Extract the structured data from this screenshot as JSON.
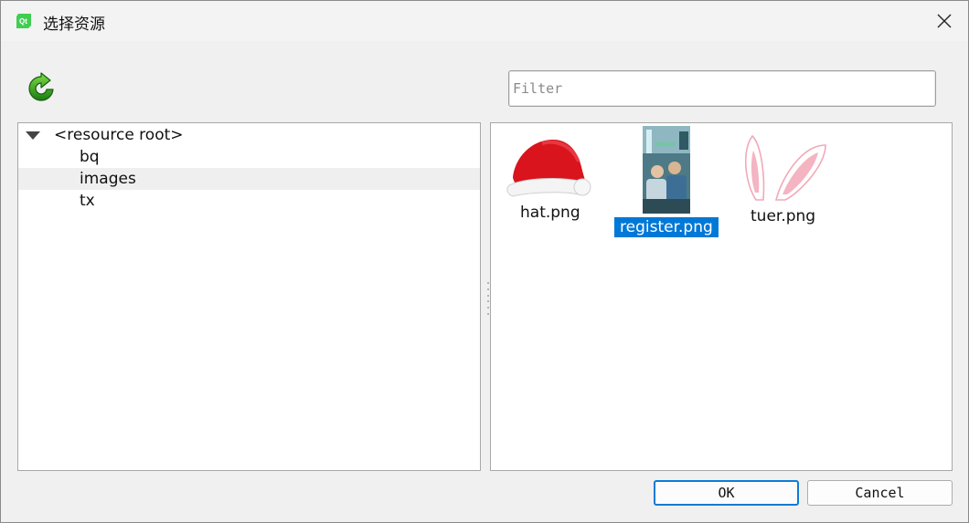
{
  "window": {
    "title": "选择资源",
    "app_icon": "qt-app-icon",
    "close_icon": "close-icon"
  },
  "toolbar": {
    "refresh_icon": "refresh-icon"
  },
  "filter": {
    "placeholder": "Filter",
    "value": ""
  },
  "tree": {
    "root_label": "<resource root>",
    "expanded": true,
    "items": [
      {
        "label": "bq"
      },
      {
        "label": "images",
        "hovered": true
      },
      {
        "label": "tx"
      }
    ]
  },
  "files": [
    {
      "name": "hat.png",
      "icon": "santa-hat-thumbnail",
      "selected": false
    },
    {
      "name": "register.png",
      "icon": "photo-thumbnail",
      "selected": true
    },
    {
      "name": "tuer.png",
      "icon": "bunny-ears-thumbnail",
      "selected": false
    }
  ],
  "buttons": {
    "ok": "OK",
    "cancel": "Cancel"
  },
  "colors": {
    "selection": "#0078d7",
    "default_button_border": "#0f7bd6",
    "hat_red": "#d9141c",
    "ears_pink": "#f2a9b8"
  }
}
